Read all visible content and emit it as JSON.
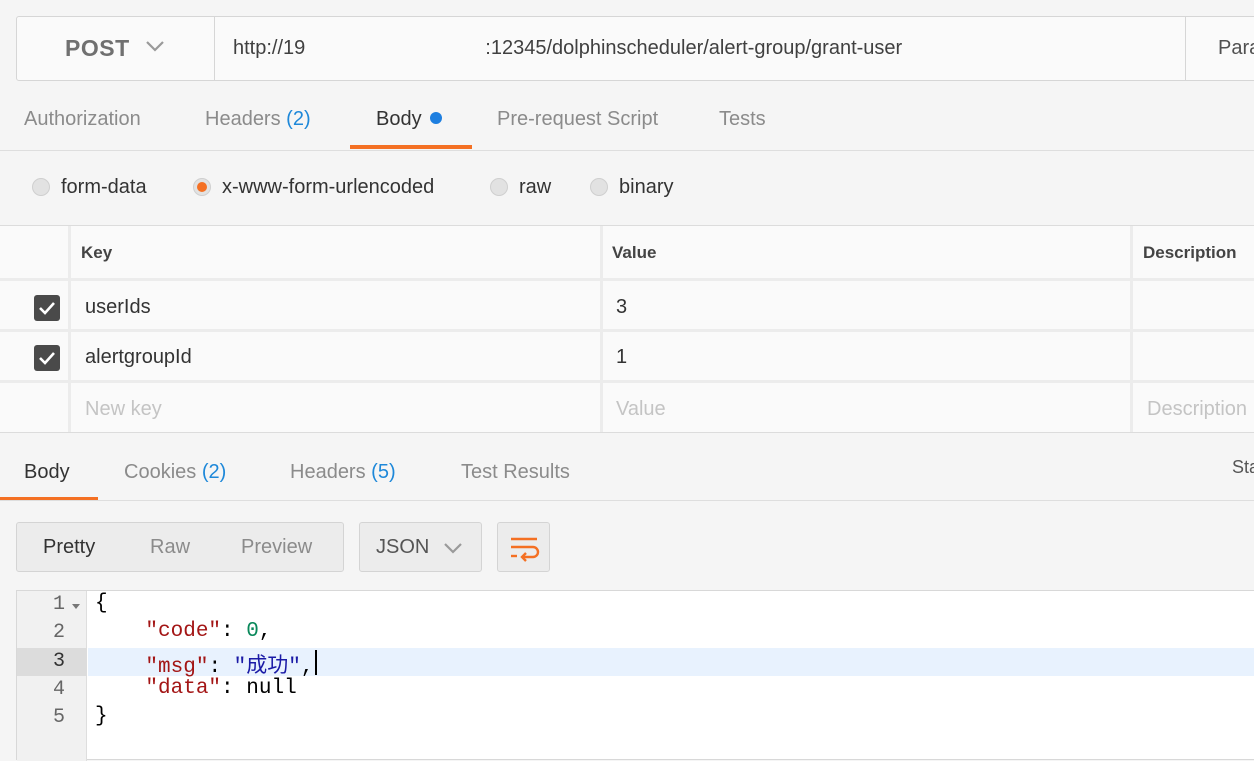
{
  "request": {
    "method": "POST",
    "url": "http://19         :12345/dolphinscheduler/alert-group/grant-user",
    "params_tab": "Para"
  },
  "request_tabs": [
    {
      "label": "Authorization"
    },
    {
      "label": "Headers",
      "count": "(2)"
    },
    {
      "label": "Body"
    },
    {
      "label": "Pre-request Script"
    },
    {
      "label": "Tests"
    }
  ],
  "body_types": [
    "form-data",
    "x-www-form-urlencoded",
    "raw",
    "binary"
  ],
  "body_type_selected": "x-www-form-urlencoded",
  "params_table": {
    "headers": {
      "key": "Key",
      "value": "Value",
      "description": "Description"
    },
    "rows": [
      {
        "key": "userIds",
        "value": "3",
        "checked": true
      },
      {
        "key": "alertgroupId",
        "value": "1",
        "checked": true
      }
    ],
    "placeholders": {
      "key": "New key",
      "value": "Value",
      "description": "Description"
    }
  },
  "response_tabs": [
    {
      "label": "Body"
    },
    {
      "label": "Cookies",
      "count": "(2)"
    },
    {
      "label": "Headers",
      "count": "(5)"
    },
    {
      "label": "Test Results"
    }
  ],
  "status_label": "Sta",
  "view_modes": [
    "Pretty",
    "Raw",
    "Preview"
  ],
  "format": "JSON",
  "code_lines": [
    {
      "num": "1"
    },
    {
      "num": "2",
      "key": "\"code\"",
      "value": "0"
    },
    {
      "num": "3",
      "key": "\"msg\"",
      "value": "\"成功\""
    },
    {
      "num": "4",
      "key": "\"data\"",
      "value": "null"
    },
    {
      "num": "5"
    }
  ],
  "colors": {
    "accent": "#f47023",
    "link": "#1e88d9",
    "dot": "#1e7fe0"
  }
}
